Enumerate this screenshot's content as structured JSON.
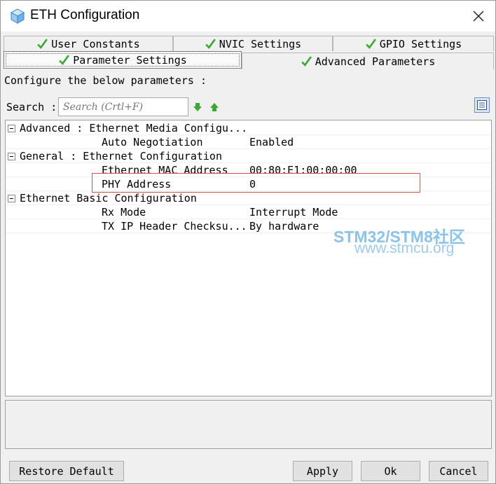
{
  "window": {
    "title": "ETH Configuration"
  },
  "tabs": [
    {
      "label": "User Constants",
      "active": false
    },
    {
      "label": "NVIC Settings",
      "active": false
    },
    {
      "label": "GPIO Settings",
      "active": false
    },
    {
      "label": "Parameter Settings",
      "active": true
    },
    {
      "label": "Advanced Parameters",
      "active": false
    }
  ],
  "description": "Configure the below parameters :",
  "search": {
    "label": "Search :",
    "placeholder": "Search (Crtl+F)"
  },
  "tree": {
    "groups": [
      {
        "label": "Advanced : Ethernet Media Configu...",
        "params": [
          {
            "name": "Auto Negotiation",
            "value": "Enabled"
          }
        ]
      },
      {
        "label": "General : Ethernet Configuration",
        "params": [
          {
            "name": "Ethernet MAC Address",
            "value": "00:80:E1:00:00:00"
          },
          {
            "name": "PHY Address",
            "value": "0"
          }
        ]
      },
      {
        "label": "Ethernet Basic Configuration",
        "params": [
          {
            "name": "Rx Mode",
            "value": "Interrupt Mode"
          },
          {
            "name": "TX IP Header Checksu...",
            "value": "By hardware"
          }
        ]
      }
    ]
  },
  "watermark": {
    "line1": "STM32/STM8社区",
    "line2": "www.stmcu.org"
  },
  "buttons": {
    "restore": "Restore Default",
    "apply": "Apply",
    "ok": "Ok",
    "cancel": "Cancel"
  },
  "colors": {
    "check": "#3aa835",
    "highlight": "#e04a4a",
    "watermark": "#8cc3e6"
  },
  "icons": [
    "app-cube-icon",
    "close-icon",
    "check-icon",
    "arrow-down-icon",
    "arrow-up-icon",
    "list-view-icon",
    "collapse-icon"
  ]
}
